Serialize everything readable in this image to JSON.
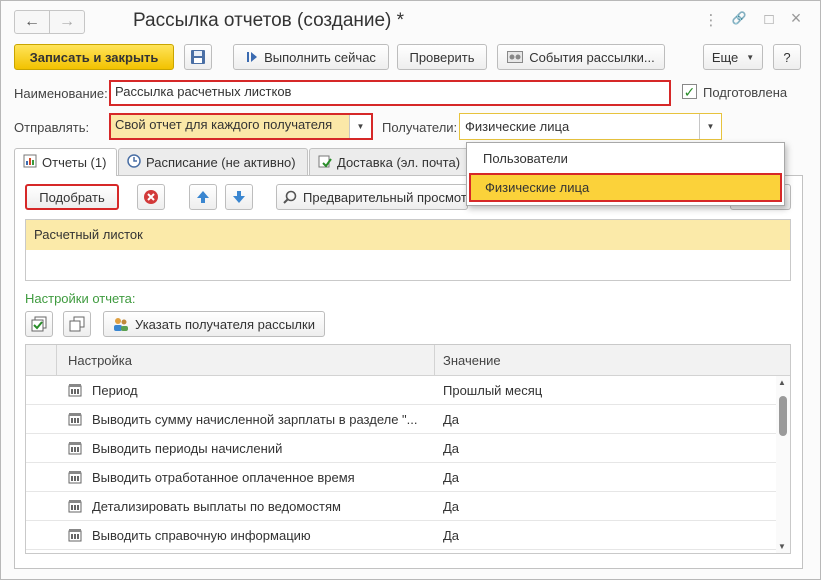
{
  "window": {
    "title": "Рассылка отчетов (создание) *",
    "nav_back": "←",
    "nav_forward": "→",
    "more_icon": "⋮",
    "link_icon": "🔗",
    "maximize_icon": "□",
    "close_icon": "×"
  },
  "toolbar": {
    "save_close": "Записать и закрыть",
    "run_now": "Выполнить сейчас",
    "check": "Проверить",
    "events": "События рассылки...",
    "more": "Еще",
    "help": "?"
  },
  "form": {
    "name_label": "Наименование:",
    "name_value": "Рассылка расчетных листков",
    "prepared_label": "Подготовлена",
    "prepared_checked": true,
    "send_label": "Отправлять:",
    "send_value": "Свой отчет для каждого получателя",
    "recipients_label": "Получатели:",
    "recipients_value": "Физические лица"
  },
  "recipients_dropdown": {
    "options": [
      {
        "label": "Пользователи",
        "selected": false
      },
      {
        "label": "Физические лица",
        "selected": true
      }
    ]
  },
  "tabs": [
    {
      "label": "Отчеты (1)",
      "active": true
    },
    {
      "label": "Расписание (не активно)",
      "active": false
    },
    {
      "label": "Доставка (эл. почта)",
      "active": false
    }
  ],
  "reports": {
    "pick_button": "Подобрать",
    "preview_button": "Предварительный просмотр",
    "items": [
      "Расчетный листок"
    ]
  },
  "settings": {
    "section_label": "Настройки отчета:",
    "recipient_button": "Указать получателя рассылки",
    "columns": [
      "Настройка",
      "Значение"
    ],
    "rows": [
      {
        "name": "Период",
        "value": "Прошлый месяц"
      },
      {
        "name": "Выводить сумму начисленной зарплаты в разделе \"...",
        "value": "Да"
      },
      {
        "name": "Выводить периоды начислений",
        "value": "Да"
      },
      {
        "name": "Выводить отработанное оплаченное время",
        "value": "Да"
      },
      {
        "name": "Детализировать выплаты по ведомостям",
        "value": "Да"
      },
      {
        "name": "Выводить справочную информацию",
        "value": "Да"
      }
    ]
  },
  "colors": {
    "accent_yellow": "#f2c200",
    "highlight": "#d62828",
    "selected_row": "#fbeaa9",
    "section_green": "#3f9b3f"
  }
}
